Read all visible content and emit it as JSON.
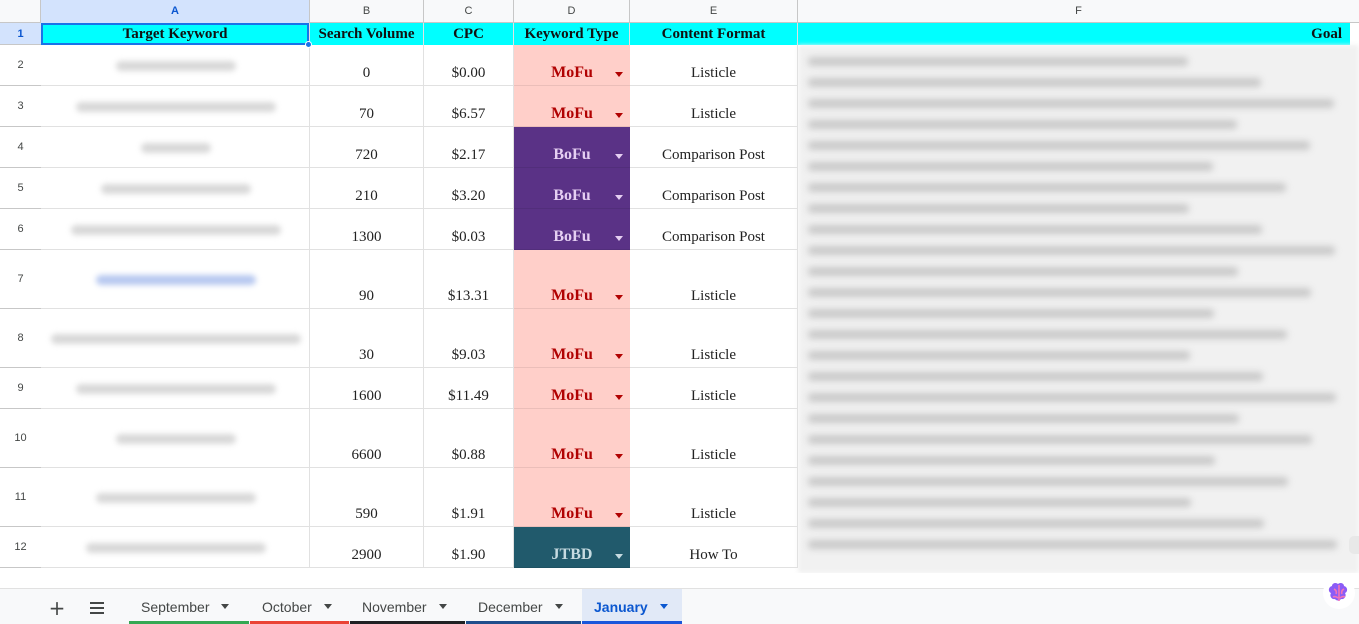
{
  "column_letters": [
    "A",
    "B",
    "C",
    "D",
    "E",
    "F"
  ],
  "row_numbers": [
    "1",
    "2",
    "3",
    "4",
    "5",
    "6",
    "7",
    "8",
    "9",
    "10",
    "11",
    "12"
  ],
  "headers": {
    "target_keyword": "Target Keyword",
    "search_volume": "Search Volume",
    "cpc": "CPC",
    "keyword_type": "Keyword Type",
    "content_format": "Content Format",
    "goal": "Goal"
  },
  "rows": [
    {
      "volume": "0",
      "cpc": "$0.00",
      "type": "MoFu",
      "format": "Listicle"
    },
    {
      "volume": "70",
      "cpc": "$6.57",
      "type": "MoFu",
      "format": "Listicle"
    },
    {
      "volume": "720",
      "cpc": "$2.17",
      "type": "BoFu",
      "format": "Comparison Post"
    },
    {
      "volume": "210",
      "cpc": "$3.20",
      "type": "BoFu",
      "format": "Comparison Post"
    },
    {
      "volume": "1300",
      "cpc": "$0.03",
      "type": "BoFu",
      "format": "Comparison Post"
    },
    {
      "volume": "90",
      "cpc": "$13.31",
      "type": "MoFu",
      "format": "Listicle"
    },
    {
      "volume": "30",
      "cpc": "$9.03",
      "type": "MoFu",
      "format": "Listicle"
    },
    {
      "volume": "1600",
      "cpc": "$11.49",
      "type": "MoFu",
      "format": "Listicle"
    },
    {
      "volume": "6600",
      "cpc": "$0.88",
      "type": "MoFu",
      "format": "Listicle"
    },
    {
      "volume": "590",
      "cpc": "$1.91",
      "type": "MoFu",
      "format": "Listicle"
    },
    {
      "volume": "2900",
      "cpc": "$1.90",
      "type": "JTBD",
      "format": "How To"
    }
  ],
  "sheet_tabs": [
    {
      "label": "September",
      "color": "#34a853"
    },
    {
      "label": "October",
      "color": "#ea4335"
    },
    {
      "label": "November",
      "color": "#202124"
    },
    {
      "label": "December",
      "color": "#1f4e8c"
    },
    {
      "label": "January",
      "color": "#1a56db",
      "active": true
    }
  ],
  "colors": {
    "header_fill": "#00ffff",
    "mofu_fill": "#ffcfc9",
    "mofu_text": "#b10202",
    "bofu_fill": "#5a3286",
    "bofu_text": "#e5cff2",
    "jtbd_fill": "#215a6c",
    "jtbd_text": "#c6dbe1",
    "selection": "#1a73e8"
  },
  "icons": {
    "add_sheet": "plus-icon",
    "all_sheets": "menu-icon",
    "assistant": "brain-icon"
  }
}
